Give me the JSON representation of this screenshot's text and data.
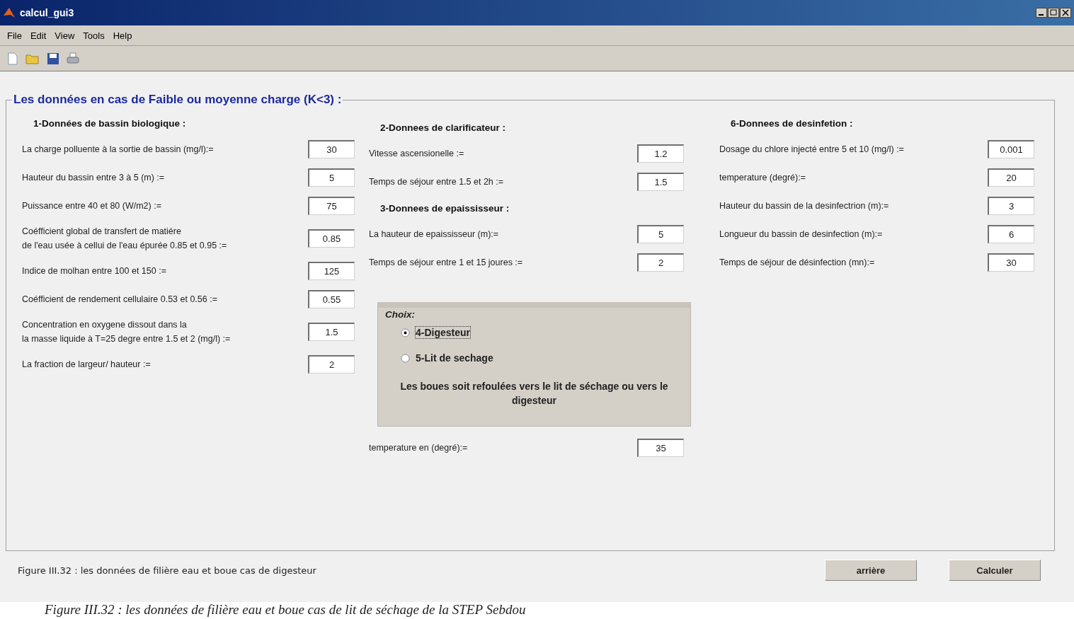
{
  "window": {
    "title": "calcul_gui3"
  },
  "menu": [
    "File",
    "Edit",
    "View",
    "Tools",
    "Help"
  ],
  "toolbar": [
    {
      "kind": "new"
    },
    {
      "kind": "open"
    },
    {
      "kind": "save"
    },
    {
      "kind": "print"
    }
  ],
  "panel": {
    "title": "Les données en cas de Faible ou moyenne charge (K<3) :",
    "columns": [
      {
        "items": [
          {
            "kind": "heading",
            "text": "1-Données de bassin biologique :"
          },
          {
            "kind": "field",
            "label": "La charge polluente à la sortie de bassin (mg/l):=",
            "value": "30"
          },
          {
            "kind": "field",
            "label": "Hauteur du bassin entre 3 à 5 (m) :=",
            "value": "5"
          },
          {
            "kind": "field",
            "label": "Puissance entre 40 et 80 (W/m2) :=",
            "value": "75"
          },
          {
            "kind": "field",
            "label": "Coéfficient global de transfert de matiére\n de l'eau usée à cellui de l'eau épurée 0.85 et 0.95 :=",
            "value": "0.85"
          },
          {
            "kind": "field",
            "label": "Indice de molhan entre 100 et 150 :=",
            "value": "125"
          },
          {
            "kind": "field",
            "label": "Coéfficient de rendement cellulaire 0.53 et 0.56 :=",
            "value": "0.55"
          },
          {
            "kind": "field",
            "label": "Concentration en oxygene dissout dans la\n la masse liquide à T=25 degre entre 1.5 et 2 (mg/l) :=",
            "value": "1.5"
          },
          {
            "kind": "field",
            "label": "La fraction de  largeur/ hauteur :=",
            "value": "2"
          }
        ]
      },
      {
        "items": [
          {
            "kind": "heading",
            "text": "2-Donnees de clarificateur :"
          },
          {
            "kind": "field",
            "label": "Vitesse ascensionelle :=",
            "value": "1.2"
          },
          {
            "kind": "field",
            "label": "Temps de séjour entre 1.5 et 2h :=",
            "value": "1.5"
          },
          {
            "kind": "heading",
            "text": "3-Donnees de epaississeur :"
          },
          {
            "kind": "field",
            "label": "La hauteur de epaississeur (m):=",
            "value": "5"
          },
          {
            "kind": "field",
            "label": "Temps de séjour entre 1 et 15 joures :=",
            "value": "2"
          },
          {
            "kind": "choice",
            "title": "Choix:",
            "options": [
              {
                "label": "4-Digesteur",
                "selected": true,
                "focused": true
              },
              {
                "label": "5-Lit de sechage",
                "selected": false,
                "focused": false
              }
            ],
            "note": "Les boues soit refoulées vers le lit de séchage ou vers le digesteur"
          },
          {
            "kind": "field",
            "label": "temperature en (degré):=",
            "value": "35"
          }
        ]
      },
      {
        "items": [
          {
            "kind": "heading",
            "text": "6-Donnees de desinfetion :"
          },
          {
            "kind": "field",
            "label": "Dosage du chlore injecté  entre 5  et 10 (mg/l) :=",
            "value": "0.001"
          },
          {
            "kind": "field",
            "label": "temperature (degré):=",
            "value": "20"
          },
          {
            "kind": "field",
            "label": "Hauteur du bassin de la desinfectrion (m):=",
            "value": "3"
          },
          {
            "kind": "field",
            "label": "Longueur du bassin de desinfection (m):=",
            "value": "6"
          },
          {
            "kind": "field",
            "label": "Temps de séjour de désinfection (mn):=",
            "value": "30"
          }
        ]
      }
    ]
  },
  "figure_note": "Figure III.32 : les données de filière eau et boue cas de digesteur",
  "buttons": [
    "arrière",
    "Calculer"
  ],
  "caption": "Figure III.32 : les données de filière eau et boue cas de lit de séchage de la STEP Sebdou"
}
